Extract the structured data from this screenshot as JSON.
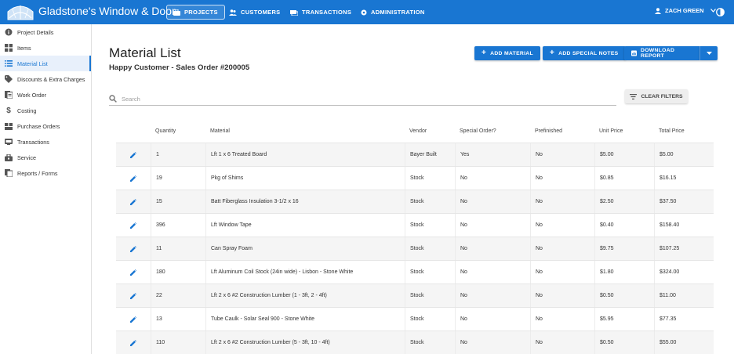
{
  "header": {
    "brand": "Gladstone's Window & Door",
    "nav": [
      {
        "label": "PROJECTS",
        "icon": "briefcase-icon",
        "active": true
      },
      {
        "label": "CUSTOMERS",
        "icon": "customers-icon",
        "active": false
      },
      {
        "label": "TRANSACTIONS",
        "icon": "transactions-icon",
        "active": false
      },
      {
        "label": "ADMINISTRATION",
        "icon": "settings-icon",
        "active": false
      }
    ],
    "user": "ZACH GREEN"
  },
  "sidebar": {
    "items": [
      {
        "label": "Project Details",
        "icon": "info-icon"
      },
      {
        "label": "Items",
        "icon": "grid-icon"
      },
      {
        "label": "Material List",
        "icon": "list-icon",
        "active": true
      },
      {
        "label": "Discounts & Extra Charges",
        "icon": "tag-icon"
      },
      {
        "label": "Work Order",
        "icon": "work-order-icon"
      },
      {
        "label": "Costing",
        "icon": "dollar-icon"
      },
      {
        "label": "Purchase Orders",
        "icon": "purchase-orders-icon"
      },
      {
        "label": "Transactions",
        "icon": "transactions-icon"
      },
      {
        "label": "Service",
        "icon": "service-icon"
      },
      {
        "label": "Reports / Forms",
        "icon": "reports-icon"
      }
    ]
  },
  "main": {
    "title": "Material List",
    "subtitle": "Happy Customer - Sales Order #200005",
    "buttons": {
      "add_material": "ADD MATERIAL",
      "add_special_notes": "ADD SPECIAL NOTES",
      "download_report": "DOWNLOAD REPORT"
    },
    "search": {
      "placeholder": "Search",
      "value": ""
    },
    "clear_filters": "CLEAR FILTERS"
  },
  "table": {
    "columns": [
      "Quantity",
      "Material",
      "Vendor",
      "Special Order?",
      "Prefinished",
      "Unit Price",
      "Total Price"
    ],
    "rows": [
      {
        "quantity": "1",
        "material": "Lft 1 x 6 Treated Board",
        "vendor": "Bayer Built",
        "special_order": "Yes",
        "prefinished": "No",
        "unit_price": "$5.00",
        "total_price": "$5.00"
      },
      {
        "quantity": "19",
        "material": "Pkg of Shims",
        "vendor": "Stock",
        "special_order": "No",
        "prefinished": "No",
        "unit_price": "$0.85",
        "total_price": "$16.15"
      },
      {
        "quantity": "15",
        "material": "Batt Fiberglass Insulation 3-1/2 x 16",
        "vendor": "Stock",
        "special_order": "No",
        "prefinished": "No",
        "unit_price": "$2.50",
        "total_price": "$37.50"
      },
      {
        "quantity": "396",
        "material": "Lft Window Tape",
        "vendor": "Stock",
        "special_order": "No",
        "prefinished": "No",
        "unit_price": "$0.40",
        "total_price": "$158.40"
      },
      {
        "quantity": "11",
        "material": "Can Spray Foam",
        "vendor": "Stock",
        "special_order": "No",
        "prefinished": "No",
        "unit_price": "$9.75",
        "total_price": "$107.25"
      },
      {
        "quantity": "180",
        "material": "Lft Aluminum Coil Stock (24in wide) - Lisbon - Stone White",
        "vendor": "Stock",
        "special_order": "No",
        "prefinished": "No",
        "unit_price": "$1.80",
        "total_price": "$324.00"
      },
      {
        "quantity": "22",
        "material": "Lft 2 x 6 #2 Construction Lumber (1 - 3ft, 2 - 4ft)",
        "vendor": "Stock",
        "special_order": "No",
        "prefinished": "No",
        "unit_price": "$0.50",
        "total_price": "$11.00"
      },
      {
        "quantity": "13",
        "material": "Tube Caulk - Solar Seal 900 - Stone White",
        "vendor": "Stock",
        "special_order": "No",
        "prefinished": "No",
        "unit_price": "$5.95",
        "total_price": "$77.35"
      },
      {
        "quantity": "110",
        "material": "Lft 2 x 6 #2 Construction Lumber (5 - 3ft, 10 - 4ft)",
        "vendor": "Stock",
        "special_order": "No",
        "prefinished": "No",
        "unit_price": "$0.50",
        "total_price": "$55.00"
      }
    ]
  },
  "colors": {
    "primary": "#1976d2",
    "sidebar_active_bg": "#e8f0fb"
  }
}
